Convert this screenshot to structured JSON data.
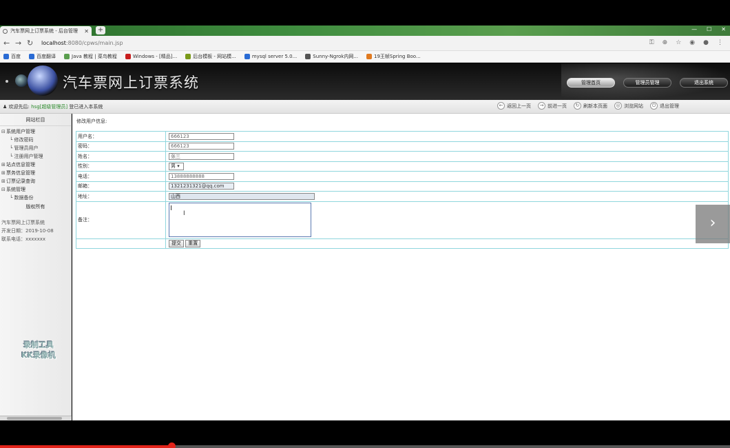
{
  "browser": {
    "tab_title": "汽车票网上订票系统 - 后台管理",
    "tab_close": "✕",
    "new_tab": "+",
    "window_controls": [
      "—",
      "☐",
      "✕"
    ],
    "url_host": "localhost",
    "url_rest": ":8080/cpws/main.jsp",
    "bookmarks": [
      {
        "label": "百度",
        "color": "#2a6bd4"
      },
      {
        "label": "百度翻译",
        "color": "#2a6bd4"
      },
      {
        "label": "Java 教程 | 菜鸟教程",
        "color": "#5a9e4e"
      },
      {
        "label": "Windows - [精品]...",
        "color": "#c81e1e"
      },
      {
        "label": "后台模板 - 网站模...",
        "color": "#7a9a1a"
      },
      {
        "label": "mysql server 5.0...",
        "color": "#2a6bd4"
      },
      {
        "label": "Sunny-Ngrok内网...",
        "color": "#555555"
      },
      {
        "label": "19王帧Spring Boo...",
        "color": "#e07a20"
      }
    ]
  },
  "header": {
    "title": "汽车票网上订票系统",
    "buttons": [
      "管理首页",
      "管理员管理",
      "退出系统"
    ]
  },
  "toolbar": {
    "welcome_prefix": "欢迎先后:",
    "user": "hsg[超级管理员]",
    "welcome_suffix": "登已进入本系统",
    "items": [
      "返回上一页",
      "前进一页",
      "刷新本页面",
      "浏览网站",
      "退出管理"
    ]
  },
  "sidebar": {
    "heading": "网站栏目",
    "tree": [
      {
        "label": "系统用户管理",
        "level": 0,
        "sign": "⊟"
      },
      {
        "label": "修改密码",
        "level": 1
      },
      {
        "label": "管理员用户",
        "level": 1
      },
      {
        "label": "注册用户管理",
        "level": 1
      },
      {
        "label": "站点信息管理",
        "level": 0,
        "sign": "⊞"
      },
      {
        "label": "票务信息管理",
        "level": 0,
        "sign": "⊞"
      },
      {
        "label": "订票记录查询",
        "level": 0,
        "sign": "⊞"
      },
      {
        "label": "系统管理",
        "level": 0,
        "sign": "⊟"
      },
      {
        "label": "数据备份",
        "level": 1
      }
    ],
    "copyright": "版权所有",
    "info": [
      "汽车票网上订票系统",
      "开发日期：2019-10-08",
      "联系电话：xxxxxxx"
    ],
    "watermark_line1": "录制工具",
    "watermark_line2": "KK录像机"
  },
  "main": {
    "breadcrumb": "修改用户信息:",
    "fields": {
      "username": {
        "label": "用户名：",
        "value": "666123"
      },
      "password": {
        "label": "密码：",
        "value": "666123"
      },
      "name": {
        "label": "姓名：",
        "value": "张三"
      },
      "gender": {
        "label": "性别：",
        "value": "男"
      },
      "phone": {
        "label": "电话：",
        "value": "13888888888"
      },
      "email": {
        "label": "邮箱：",
        "value": "1321231321@qq.com"
      },
      "address": {
        "label": "地址：",
        "value": "山西"
      },
      "remark": {
        "label": "备注：",
        "value": ""
      }
    },
    "submit_label": "提交",
    "reset_label": "重置",
    "next_arrow": "›"
  },
  "video": {
    "progress": 0.235,
    "color": "#e2231a"
  }
}
